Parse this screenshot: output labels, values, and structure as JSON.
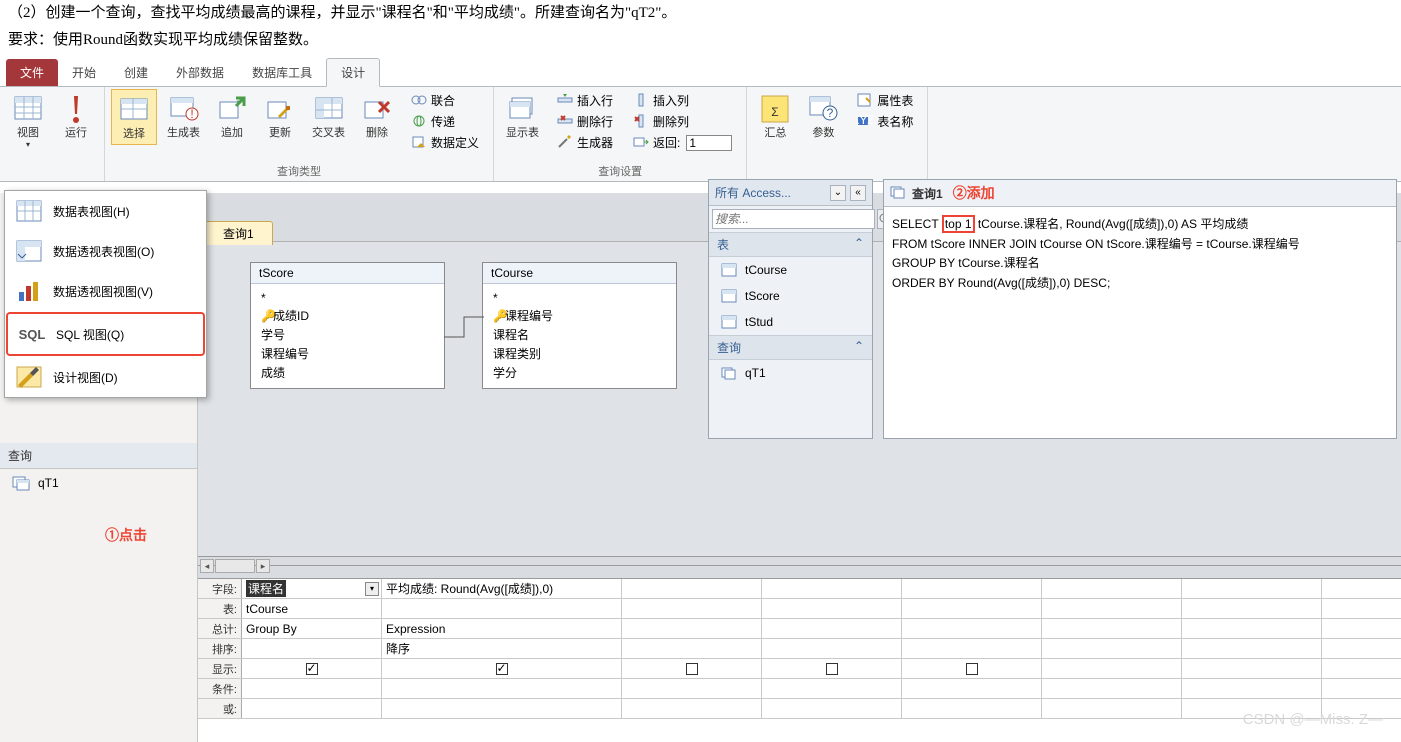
{
  "header": {
    "line1": "（2）创建一个查询，查找平均成绩最高的课程，并显示\"课程名\"和\"平均成绩\"。所建查询名为\"qT2\"。",
    "line2": "要求：使用Round函数实现平均成绩保留整数。"
  },
  "tabs": {
    "file": "文件",
    "home": "开始",
    "create": "创建",
    "external": "外部数据",
    "dbtools": "数据库工具",
    "design": "设计"
  },
  "ribbon": {
    "view": "视图",
    "run": "运行",
    "select": "选择",
    "maketable": "生成表",
    "append": "追加",
    "update": "更新",
    "crosstab": "交叉表",
    "delete": "删除",
    "union": "联合",
    "passthrough": "传递",
    "datadef": "数据定义",
    "showtable": "显示表",
    "insertrow": "插入行",
    "deleterow": "删除行",
    "builder": "生成器",
    "insertcol": "插入列",
    "deletecol": "删除列",
    "return": "返回:",
    "totals": "汇总",
    "params": "参数",
    "propsheet": "属性表",
    "tablenames": "表名称",
    "group_results": "",
    "group_querytype": "查询类型",
    "group_querysetup": "查询设置",
    "group_showhide": "",
    "return_value": "1"
  },
  "viewmenu": {
    "datasheet": "数据表视图(H)",
    "pivottable": "数据透视表视图(O)",
    "pivotchart": "数据透视图视图(V)",
    "sql": "SQL 视图(Q)",
    "design": "设计视图(D)",
    "ann": "①点击"
  },
  "nav": {
    "section": "查询",
    "item": "qT1"
  },
  "querytab": "查询1",
  "tscore": {
    "title": "tScore",
    "star": "*",
    "f1": "成绩ID",
    "f2": "学号",
    "f3": "课程编号",
    "f4": "成绩"
  },
  "tcourse": {
    "title": "tCourse",
    "star": "*",
    "f1": "课程编号",
    "f2": "课程名",
    "f3": "课程类别",
    "f4": "学分"
  },
  "qbe": {
    "labels": {
      "field": "字段:",
      "table": "表:",
      "total": "总计:",
      "sort": "排序:",
      "show": "显示:",
      "criteria": "条件:",
      "or": "或:"
    },
    "col1": {
      "field": "课程名",
      "table": "tCourse",
      "total": "Group By",
      "sort": ""
    },
    "col2": {
      "field": "平均成绩: Round(Avg([成绩]),0)",
      "table": "",
      "total": "Expression",
      "sort": "降序"
    }
  },
  "access": {
    "title": "所有 Access...",
    "search_ph": "搜索...",
    "sec_tables": "表",
    "sec_queries": "查询",
    "t1": "tCourse",
    "t2": "tScore",
    "t3": "tStud",
    "q1": "qT1"
  },
  "sql": {
    "tab": "查询1",
    "ann": "②添加",
    "hl": "top 1",
    "before": "SELECT ",
    "after": " tCourse.课程名, Round(Avg([成绩]),0) AS 平均成绩\nFROM tScore INNER JOIN tCourse ON tScore.课程编号 = tCourse.课程编号\nGROUP BY tCourse.课程名\nORDER BY Round(Avg([成绩]),0) DESC;"
  },
  "watermark": "CSDN @—Miss. Z—"
}
